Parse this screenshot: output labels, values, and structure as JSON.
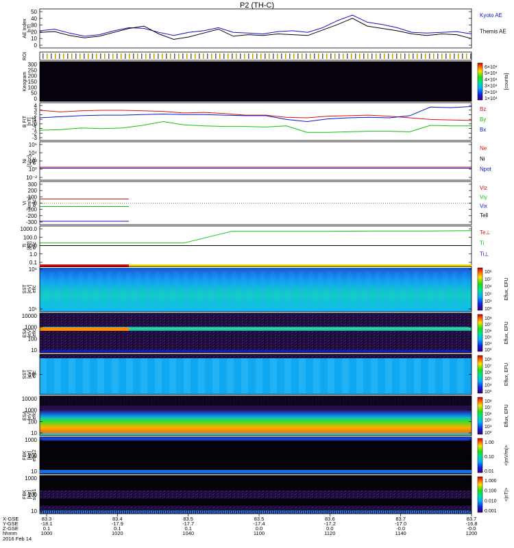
{
  "title": "P2 (TH-C)",
  "colors": {
    "black": "#000000",
    "blue": "#1010c8",
    "red": "#d81010",
    "green": "#10c010",
    "bg_dark": "#1a0a28",
    "spec_cyan": "#18b8ff"
  },
  "panels": [
    {
      "key": "ae",
      "ylabel": [
        "AE Index",
        "[nT]"
      ],
      "ticks": [
        "50",
        "40",
        "30",
        "20",
        "10",
        "0"
      ],
      "legend": [
        {
          "text": "Kyoto AE",
          "color": "#1010c8"
        },
        {
          "text": "Themis AE",
          "color": "#000000"
        }
      ]
    },
    {
      "key": "roi",
      "ylabel": [
        "ROI"
      ],
      "ticks": []
    },
    {
      "key": "keogram",
      "ylabel": [
        "Keogram"
      ],
      "ticks": [
        "300",
        "250",
        "200",
        "150",
        "100",
        "50",
        "0"
      ],
      "cbar_ticks": [
        "6×10⁴",
        "5×10⁴",
        "4×10⁴",
        "3×10⁴",
        "2×10⁴",
        "1×10⁴"
      ],
      "cbar_label": "[counts]"
    },
    {
      "key": "bfield",
      "ylabel": [
        "B FIT",
        "[nT]",
        "GSE"
      ],
      "ticks": [
        "4",
        "3",
        "2",
        "1",
        "0",
        "-1",
        "-2",
        "-3"
      ],
      "legend": [
        {
          "text": "Bz",
          "color": "#d81010"
        },
        {
          "text": "By",
          "color": "#10c010"
        },
        {
          "text": "Bx",
          "color": "#1010c8"
        }
      ]
    },
    {
      "key": "density",
      "ylabel": [
        "Ni",
        "[1/cc]",
        "eflc"
      ],
      "ticks": [
        "10⁶",
        "10⁴",
        "10²",
        "10⁰",
        "10⁻²"
      ],
      "legend": [
        {
          "text": "Ne",
          "color": "#d81010"
        },
        {
          "text": "Ni",
          "color": "#000000"
        },
        {
          "text": "Npot",
          "color": "#1010c8"
        }
      ]
    },
    {
      "key": "velocity",
      "ylabel": [
        "Vi",
        "[km/s]",
        "eflc"
      ],
      "ticks": [
        "300",
        "200",
        "100",
        "0",
        "-100",
        "-200",
        "-300"
      ],
      "legend": [
        {
          "text": "Viz",
          "color": "#d81010"
        },
        {
          "text": "Viy",
          "color": "#10c010"
        },
        {
          "text": "Vix",
          "color": "#1010c8"
        },
        {
          "text": "Tell",
          "color": "#000000"
        }
      ]
    },
    {
      "key": "temp",
      "ylabel": [
        "Ti",
        "[eV]",
        "eflc"
      ],
      "ticks": [
        "1000.0",
        "100.0",
        "10.0",
        "1.0",
        "0.1"
      ],
      "legend": [
        {
          "text": "Te⊥",
          "color": "#d81010"
        },
        {
          "text": "Ti",
          "color": "#10c010"
        },
        {
          "text": "Ti⊥",
          "color": "#1010c8"
        }
      ]
    },
    {
      "key": "sst_e",
      "ylabel": [
        "SST",
        "[eV]",
        "eflc"
      ],
      "ticks": [
        "10⁶",
        "10⁵"
      ],
      "cbar_ticks": [
        "10⁸",
        "10⁷",
        "10⁶",
        "10⁵",
        "10⁴",
        "10³"
      ],
      "cbar_label": "Eflux, EFU"
    },
    {
      "key": "esa_i",
      "ylabel": [
        "ESA",
        "[eV]",
        "eflc"
      ],
      "ticks": [
        "10000",
        "1000",
        "100",
        "10"
      ],
      "cbar_ticks": [
        "10⁸",
        "10⁷",
        "10⁶",
        "10⁵",
        "10⁴",
        "10³"
      ],
      "cbar_label": "Eflux, EFU"
    },
    {
      "key": "sst_i",
      "ylabel": [
        "SST",
        "[eV]",
        "eflc"
      ],
      "ticks": [
        "10⁵"
      ],
      "cbar_ticks": [
        "10⁸",
        "10⁷",
        "10⁶",
        "10⁵",
        "10⁴",
        "10³"
      ],
      "cbar_label": "Eflux, EFU"
    },
    {
      "key": "esa_e",
      "ylabel": [
        "ESA",
        "[eV]",
        "eflc"
      ],
      "ticks": [
        "10000",
        "1000",
        "100",
        "10"
      ],
      "cbar_ticks": [
        "10⁸",
        "10⁷",
        "10⁶",
        "10⁵",
        "10⁴",
        "10³"
      ],
      "cbar_label": "Eflux, EFU"
    },
    {
      "key": "fbk_e",
      "ylabel": [
        "FBK",
        "[Hz]",
        "efp12"
      ],
      "ticks": [
        "1000",
        "100",
        "10"
      ],
      "cbar_ticks": [
        "1.00",
        "0.10",
        "0.01"
      ],
      "cbar_label": "<|mV/m|>"
    },
    {
      "key": "fbk_b",
      "ylabel": [
        "FBK",
        "[Hz]",
        "scm1"
      ],
      "ticks": [
        "1000",
        "100",
        "10"
      ],
      "cbar_ticks": [
        "1.000",
        "0.100",
        "0.010",
        "0.001"
      ],
      "cbar_label": "<|nT|>"
    }
  ],
  "x_axis": {
    "row_labels": [
      "X-GSE",
      "Y-GSE",
      "Z-GSE",
      "hhmm",
      "2016 Feb 14"
    ],
    "columns": [
      {
        "x": "83.3",
        "y": "-18.1",
        "z": "0.1",
        "t": "1000"
      },
      {
        "x": "83.4",
        "y": "-17.9",
        "z": "0.1",
        "t": "1020"
      },
      {
        "x": "83.5",
        "y": "-17.7",
        "z": "0.1",
        "t": "1040"
      },
      {
        "x": "83.5",
        "y": "-17.4",
        "z": "0.0",
        "t": "1100"
      },
      {
        "x": "83.6",
        "y": "-17.2",
        "z": "0.0",
        "t": "1120"
      },
      {
        "x": "83.7",
        "y": "-17.0",
        "z": "-0.0",
        "t": "1140"
      },
      {
        "x": "83.7",
        "y": "-16.8",
        "z": "-0.0",
        "t": "1200"
      }
    ]
  },
  "chart_data": {
    "type": "line",
    "title": "P2 (TH-C)",
    "x_range": [
      "1000",
      "1200"
    ],
    "ae": {
      "ylim": [
        0,
        50
      ],
      "series": [
        {
          "name": "Kyoto AE",
          "values": [
            22,
            24,
            19,
            15,
            17,
            22,
            26,
            25,
            20,
            16,
            20,
            22,
            26,
            20,
            19,
            18,
            21,
            22,
            20,
            26,
            35,
            42,
            33,
            30,
            26,
            20,
            19,
            20,
            21,
            18
          ]
        },
        {
          "name": "Themis AE",
          "values": [
            20,
            21,
            16,
            13,
            15,
            20,
            25,
            28,
            18,
            11,
            14,
            19,
            24,
            15,
            17,
            16,
            18,
            17,
            16,
            23,
            30,
            38,
            28,
            25,
            22,
            18,
            16,
            18,
            17,
            12
          ]
        }
      ]
    },
    "bfield": {
      "ylim": [
        -3,
        4
      ],
      "series": [
        {
          "name": "Bz",
          "values": [
            2.6,
            2.3,
            2.5,
            2.6,
            2.6,
            2.5,
            2.4,
            2.1,
            2.2,
            2.0,
            1.7,
            1.7,
            1.3,
            1.2,
            1.5,
            1.6,
            1.7,
            1.5,
            1.2,
            0.9,
            0.8,
            0.7
          ]
        },
        {
          "name": "By",
          "values": [
            -1.1,
            -1.0,
            -0.7,
            -0.8,
            -0.7,
            -0.2,
            0.5,
            -0.1,
            -0.3,
            -0.4,
            -0.4,
            -0.5,
            -0.3,
            -1.5,
            -1.5,
            -1.4,
            -1.3,
            -1.3,
            -1.4,
            -0.2,
            -0.3,
            -0.3
          ]
        },
        {
          "name": "Bx",
          "values": [
            1.2,
            1.4,
            1.6,
            1.7,
            1.7,
            1.8,
            1.9,
            1.8,
            1.8,
            1.7,
            1.6,
            1.6,
            0.9,
            0.5,
            1.0,
            1.2,
            1.3,
            1.2,
            1.6,
            3.2,
            3.1,
            3.3
          ]
        }
      ]
    },
    "temp": {
      "ylim_log": [
        0.1,
        1000
      ],
      "series": [
        {
          "name": "Ti",
          "values": [
            20,
            20,
            20,
            20,
            500,
            500,
            500,
            550,
            550,
            600
          ]
        },
        {
          "name": "Tell",
          "values": [
            10,
            10,
            10,
            10,
            10,
            10,
            10,
            10,
            10,
            10
          ]
        }
      ]
    }
  }
}
